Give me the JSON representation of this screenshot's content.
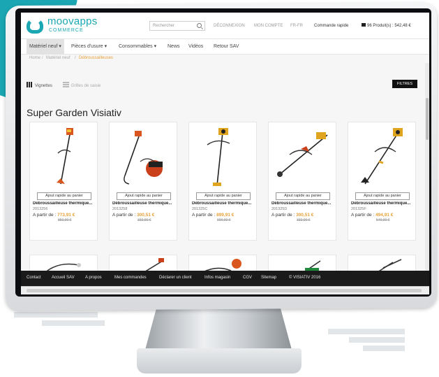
{
  "header": {
    "brand": "moovapps",
    "brand_sub": "COMMERCE",
    "search_placeholder": "Rechercher",
    "links": [
      "DÉCONNEXION",
      "MON COMPTE",
      "FR-FR",
      "Commande rapide",
      "96 Produit(s) : 542,48 €"
    ]
  },
  "nav": {
    "items": [
      "Matériel neuf",
      "Pièces d'usure",
      "Consommables",
      "News",
      "Vidéos",
      "Retour SAV"
    ]
  },
  "breadcrumb": [
    "Home",
    "Matériel neuf",
    "Débroussailleuses"
  ],
  "view": {
    "thumbnails_label": "Vignettes",
    "grid_label": "Grilles de saisie",
    "filters_label": "FILTRES"
  },
  "page_title": "Super Garden Visiativ",
  "products": [
    {
      "add_label": "Ajout rapide au panier",
      "name": "Débroussailleuse thermique...",
      "ref": "2013256",
      "from_label": "A partir de :",
      "price": "773,91 €",
      "old_price": "859,90 €"
    },
    {
      "add_label": "Ajout rapide au panier",
      "name": "Débroussailleuse thermique...",
      "ref": "2013258",
      "from_label": "A partir de :",
      "price": "300,51 €",
      "old_price": "333,90 €"
    },
    {
      "add_label": "Ajout rapide au panier",
      "name": "Débroussailleuse thermique...",
      "ref": "201325C",
      "from_label": "A partir de :",
      "price": "899,91 €",
      "old_price": "999,90 €"
    },
    {
      "add_label": "Ajout rapide au panier",
      "name": "Débroussailleuse thermique...",
      "ref": "201325D",
      "from_label": "A partir de :",
      "price": "300,51 €",
      "old_price": "333,90 €"
    },
    {
      "add_label": "Ajout rapide au panier",
      "name": "Débroussailleuse thermique...",
      "ref": "201325F",
      "from_label": "A partir de :",
      "price": "494,91 €",
      "old_price": "549,90 €"
    }
  ],
  "footer": {
    "links": [
      "Contact",
      "Accueil SAV",
      "A propos",
      "Mes commandes",
      "Déclarer un client",
      "Infos magasin",
      "CGV",
      "Sitemap",
      "© VISIATIV 2016"
    ]
  },
  "colors": {
    "accent": "#1aa7b3",
    "price": "#e8a13a",
    "footer_bg": "#1a1a1a"
  }
}
